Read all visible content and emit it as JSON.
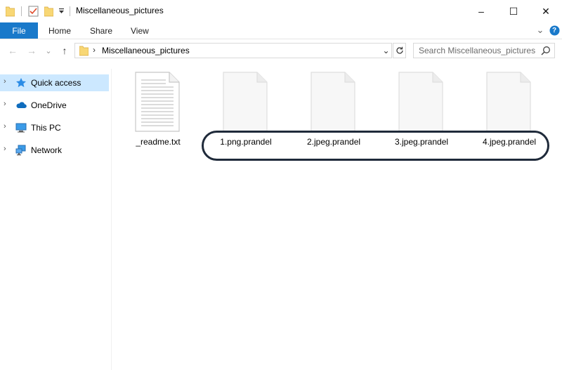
{
  "window": {
    "title": "Miscellaneous_pictures",
    "controls": {
      "minimize": "–",
      "maximize": "☐",
      "close": "✕"
    }
  },
  "ribbon": {
    "tabs": [
      "File",
      "Home",
      "Share",
      "View"
    ],
    "collapse_glyph": "⌄",
    "help_glyph": "?"
  },
  "navigation": {
    "back": "←",
    "forward": "→",
    "recent": "⌄",
    "up": "↑",
    "path_separator": "›",
    "path": "Miscellaneous_pictures",
    "address_dropdown": "⌄",
    "search_placeholder": "Search Miscellaneous_pictures"
  },
  "sidebar": {
    "items": [
      {
        "label": "Quick access",
        "icon": "star-icon",
        "selected": true
      },
      {
        "label": "OneDrive",
        "icon": "cloud-icon",
        "selected": false
      },
      {
        "label": "This PC",
        "icon": "computer-icon",
        "selected": false
      },
      {
        "label": "Network",
        "icon": "network-icon",
        "selected": false
      }
    ]
  },
  "files": [
    {
      "name": "_readme.txt",
      "type": "text"
    },
    {
      "name": "1.png.prandel",
      "type": "blank"
    },
    {
      "name": "2.jpeg.prandel",
      "type": "blank"
    },
    {
      "name": "3.jpeg.prandel",
      "type": "blank"
    },
    {
      "name": "4.jpeg.prandel",
      "type": "blank"
    }
  ],
  "colors": {
    "accent": "#1979ca",
    "selection": "#cce8ff",
    "folder": "#f8d775",
    "highlight_outline": "#1f2a3a"
  }
}
